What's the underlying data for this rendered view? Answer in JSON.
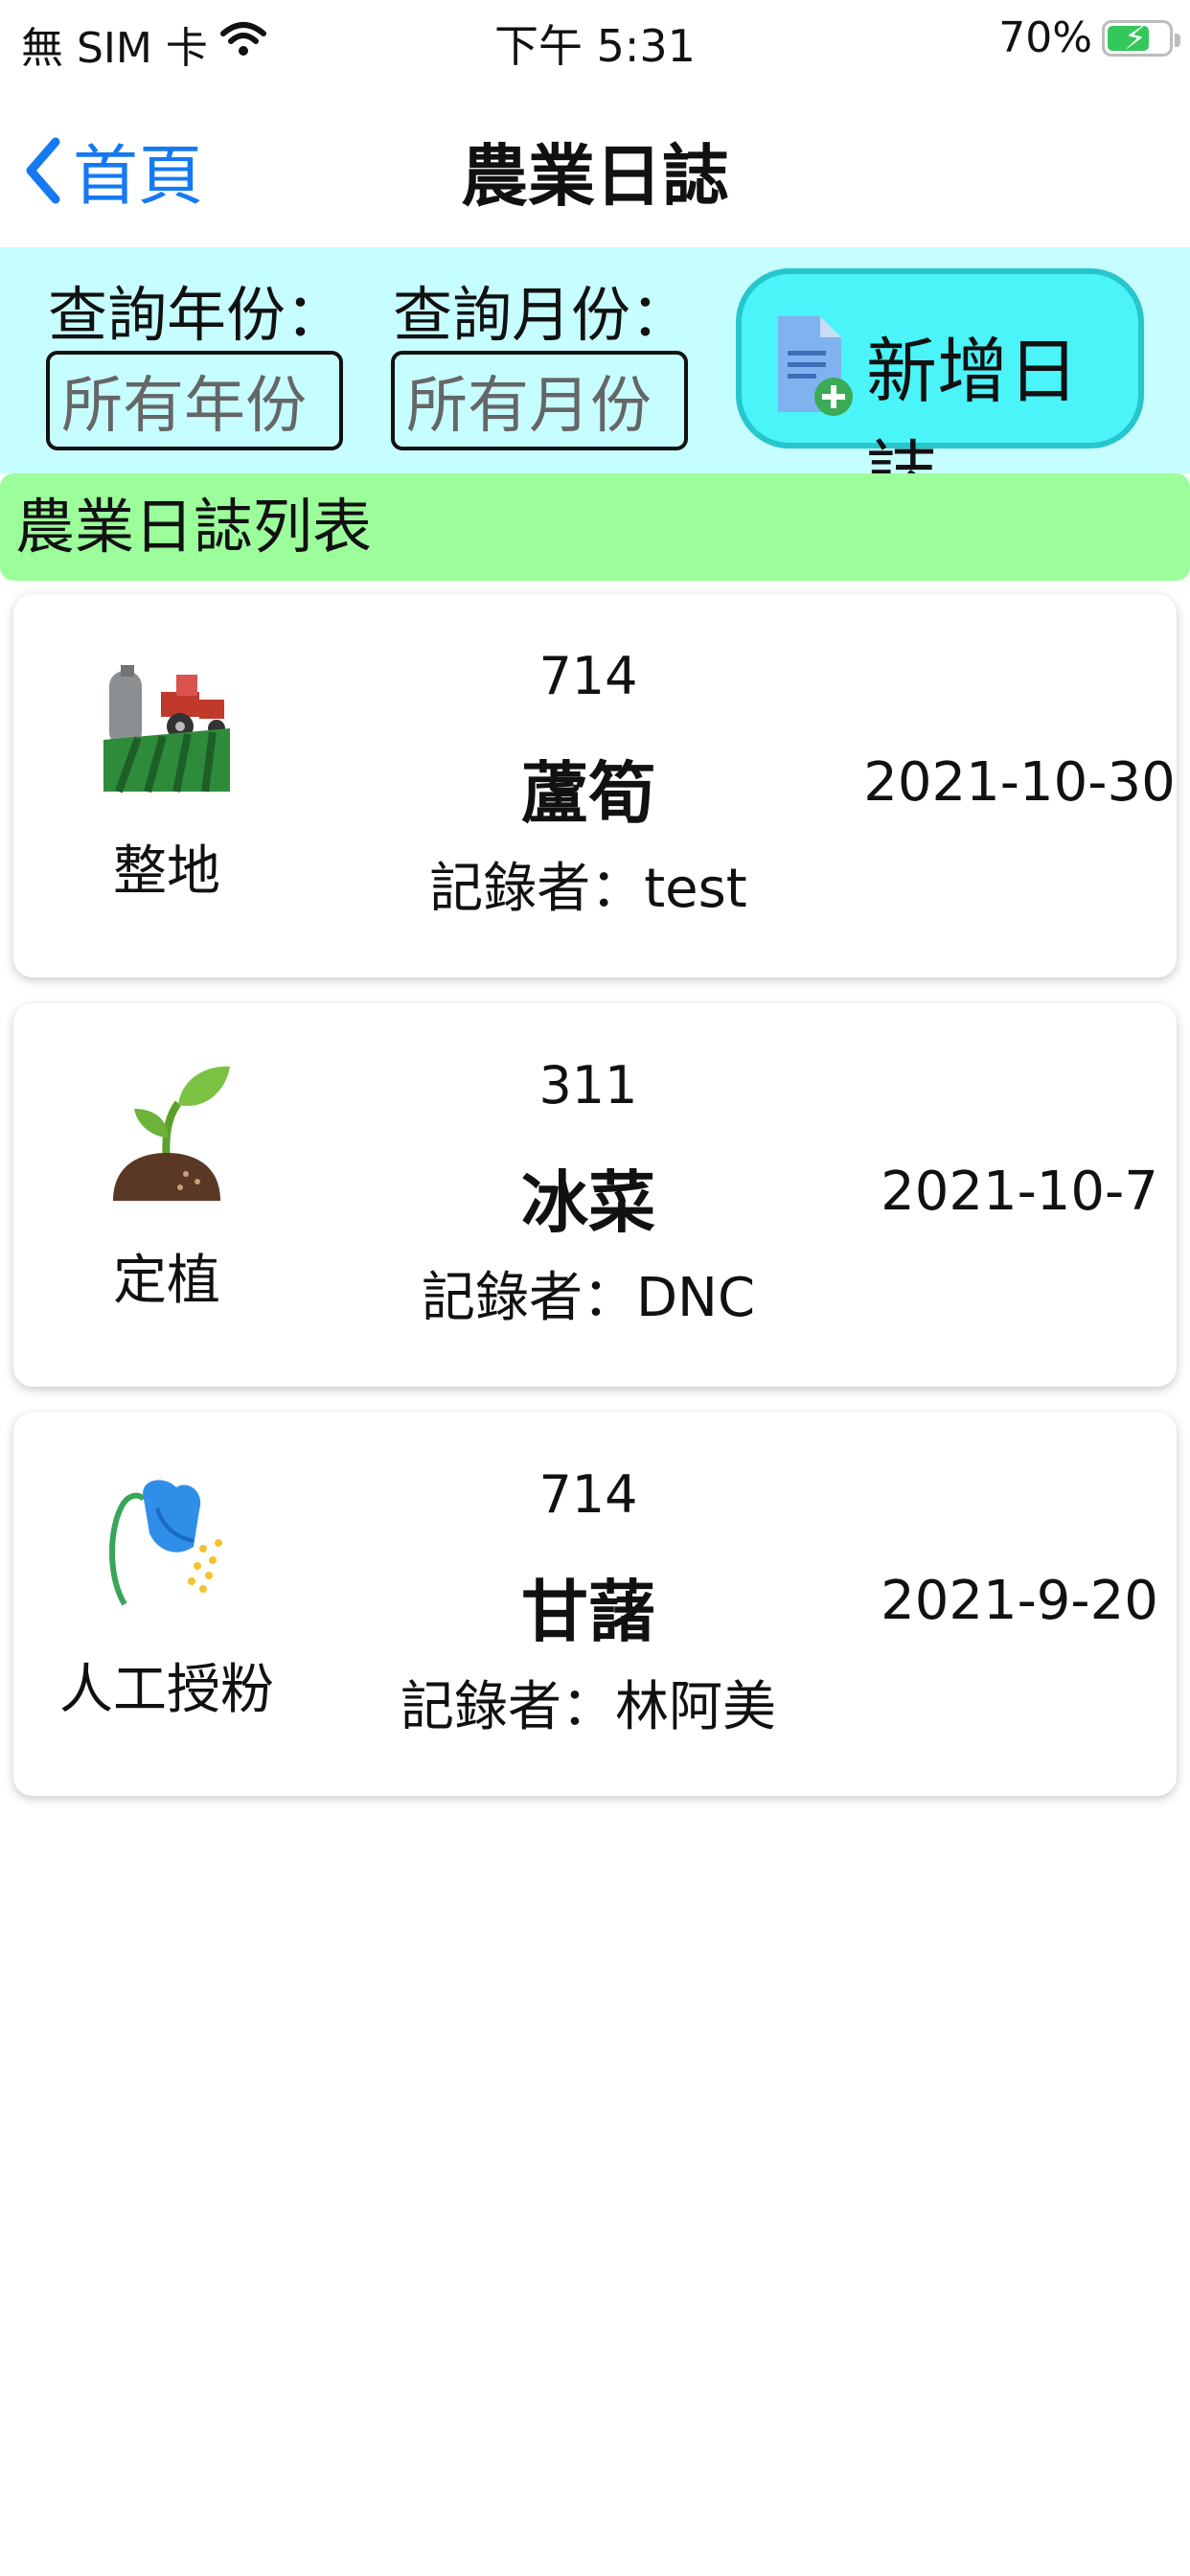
{
  "status_bar": {
    "carrier": "無 SIM 卡",
    "time": "下午 5:31",
    "battery_percent": "70%",
    "battery_level": 0.7
  },
  "nav": {
    "back_label": "首頁",
    "title": "農業日誌"
  },
  "search": {
    "year_label": "查詢年份：",
    "year_value": "所有年份",
    "month_label": "查詢月份：",
    "month_value": "所有月份",
    "add_button_label": "新增日誌"
  },
  "list": {
    "header": "農業日誌列表",
    "items": [
      {
        "icon": "tractor-farm-icon",
        "type": "整地",
        "number": "714",
        "crop": "蘆筍",
        "recorder": "記錄者：test",
        "date": "2021-10-30"
      },
      {
        "icon": "seedling-icon",
        "type": "定植",
        "number": "311",
        "crop": "冰菜",
        "recorder": "記錄者：DNC",
        "date": "2021-10-7"
      },
      {
        "icon": "flower-pollen-icon",
        "type": "人工授粉",
        "number": "714",
        "crop": "甘藷",
        "recorder": "記錄者：林阿美",
        "date": "2021-9-20"
      }
    ]
  },
  "colors": {
    "accent_blue": "#1579f2",
    "search_bg": "#c6fdff",
    "add_button_bg": "#4af4f9",
    "list_header_bg": "#9bfe9b",
    "battery_green": "#34c759"
  }
}
